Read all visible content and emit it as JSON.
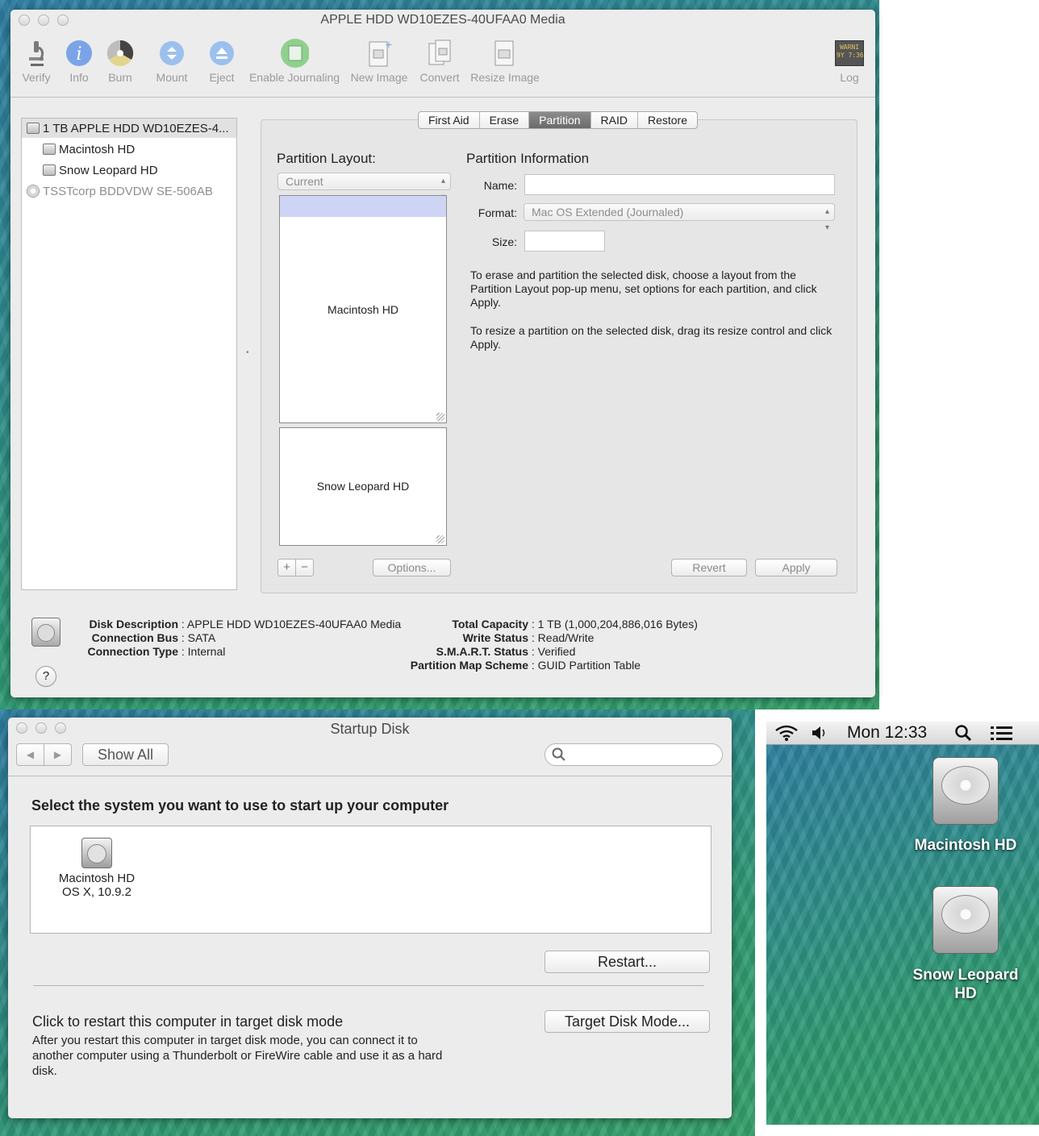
{
  "disk_utility": {
    "title": "APPLE HDD WD10EZES-40UFAA0 Media",
    "toolbar": [
      {
        "label": "Verify",
        "icon": "microscope-icon"
      },
      {
        "label": "Info",
        "icon": "info-icon"
      },
      {
        "label": "Burn",
        "icon": "burn-icon"
      },
      {
        "label": "Mount",
        "icon": "mount-icon"
      },
      {
        "label": "Eject",
        "icon": "eject-icon"
      },
      {
        "label": "Enable Journaling",
        "icon": "journaling-icon"
      },
      {
        "label": "New Image",
        "icon": "new-image-icon"
      },
      {
        "label": "Convert",
        "icon": "convert-icon"
      },
      {
        "label": "Resize Image",
        "icon": "resize-image-icon"
      }
    ],
    "log_label": "Log",
    "log_icon_text": "WARNI\n9Y 7:36",
    "sidebar": [
      "1 TB APPLE HDD WD10EZES-4...",
      "Macintosh HD",
      "Snow Leopard HD",
      "TSSTcorp BDDVDW SE-506AB"
    ],
    "tabs": [
      "First Aid",
      "Erase",
      "Partition",
      "RAID",
      "Restore"
    ],
    "active_tab": "Partition",
    "partition_layout_label": "Partition Layout:",
    "layout_value": "Current",
    "partitions": [
      "Macintosh HD",
      "Snow Leopard HD"
    ],
    "partition_info_label": "Partition Information",
    "name_label": "Name:",
    "format_label": "Format:",
    "format_value": "Mac OS Extended (Journaled)",
    "size_label": "Size:",
    "help_text_1": "To erase and partition the selected disk, choose a layout from the Partition Layout pop-up menu, set options for each partition, and click Apply.",
    "help_text_2": "To resize a partition on the selected disk, drag its resize control and click Apply.",
    "add_label": "+",
    "remove_label": "−",
    "options_label": "Options...",
    "revert_label": "Revert",
    "apply_label": "Apply",
    "details_left": [
      {
        "key": "Disk Description",
        "value": "APPLE HDD WD10EZES-40UFAA0 Media"
      },
      {
        "key": "Connection Bus",
        "value": "SATA"
      },
      {
        "key": "Connection Type",
        "value": "Internal"
      }
    ],
    "details_right": [
      {
        "key": "Total Capacity",
        "value": "1 TB (1,000,204,886,016 Bytes)"
      },
      {
        "key": "Write Status",
        "value": "Read/Write"
      },
      {
        "key": "S.M.A.R.T. Status",
        "value": "Verified"
      },
      {
        "key": "Partition Map Scheme",
        "value": "GUID Partition Table"
      }
    ],
    "help_button": "?"
  },
  "startup_disk": {
    "title": "Startup Disk",
    "show_all": "Show All",
    "search_placeholder": "",
    "heading": "Select the system you want to use to start up your computer",
    "disk_name": "Macintosh HD",
    "disk_os": "OS X, 10.9.2",
    "restart_label": "Restart...",
    "target_heading": "Click to restart this computer in target disk mode",
    "target_text": "After you restart this computer in target disk mode, you can connect it to another computer using a Thunderbolt or FireWire cable and use it as a hard disk.",
    "target_button": "Target Disk Mode..."
  },
  "desktop": {
    "clock": "Mon 12:33",
    "icons": [
      "Macintosh HD",
      "Snow Leopard HD"
    ]
  }
}
